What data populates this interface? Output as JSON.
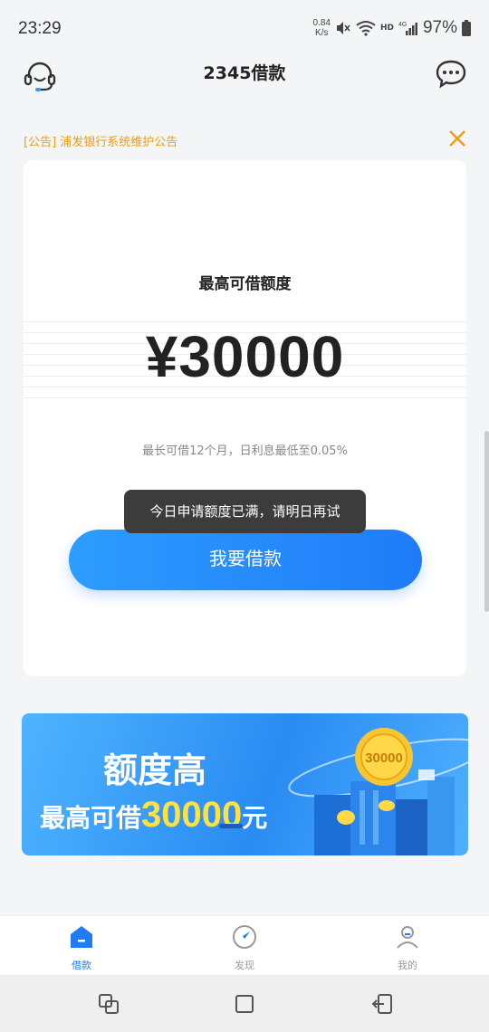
{
  "status_bar": {
    "time": "23:29",
    "net_speed_value": "0.84",
    "net_speed_unit": "K/s",
    "signal_label": "HD",
    "network_label": "4G",
    "battery": "97%"
  },
  "header": {
    "title": "2345借款"
  },
  "notice": {
    "text": "[公告] 浦发银行系统维护公告"
  },
  "card": {
    "label": "最高可借额度",
    "amount": "¥30000",
    "sub_text": "最长可借12个月，日利息最低至0.05%",
    "borrow_button": "我要借款"
  },
  "toast": {
    "text": "今日申请额度已满，请明日再试"
  },
  "banner": {
    "line1": "额度高",
    "line2_prefix": "最高可借",
    "line2_amount": "30000",
    "line2_suffix": "元",
    "coin_text": "30000"
  },
  "tabbar": {
    "tabs": [
      {
        "label": "借款",
        "icon": "home-icon",
        "active": true
      },
      {
        "label": "发现",
        "icon": "compass-icon",
        "active": false
      },
      {
        "label": "我的",
        "icon": "user-icon",
        "active": false
      }
    ]
  },
  "colors": {
    "accent": "#1f7cf7",
    "notice": "#f39c12",
    "highlight": "#ffe23c"
  }
}
